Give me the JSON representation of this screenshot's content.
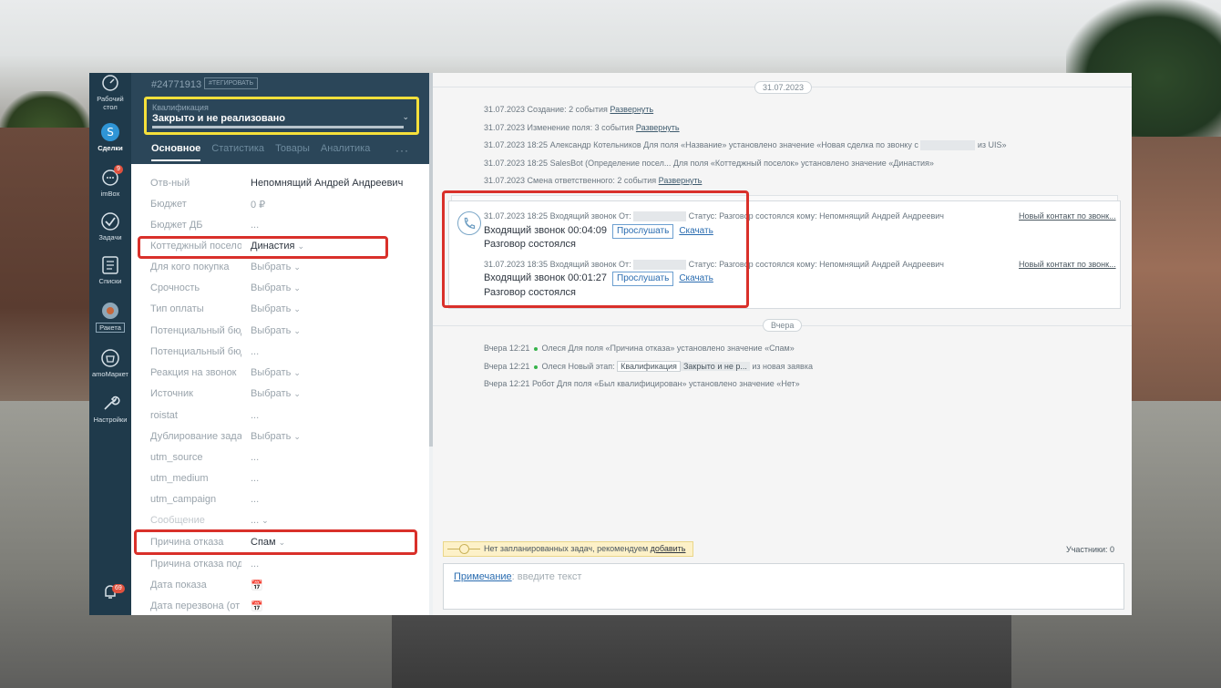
{
  "nav": {
    "items": [
      {
        "label_1": "Рабочий",
        "label_2": "стол",
        "icon": "dashboard-icon"
      },
      {
        "label": "Сделки",
        "icon": "deals-icon"
      },
      {
        "label": "imBox",
        "icon": "chat-icon",
        "badge": "9"
      },
      {
        "label": "Задачи",
        "icon": "tasks-icon"
      },
      {
        "label": "Списки",
        "icon": "lists-icon"
      },
      {
        "label": "Ракета",
        "icon": "rocket-icon"
      },
      {
        "label": "amoМаркет",
        "icon": "market-icon"
      },
      {
        "label": "Настройки",
        "icon": "settings-icon"
      }
    ],
    "notifications_badge": "69"
  },
  "card": {
    "deal_id": "#24771913",
    "tag_button": "#ТЕГИРОВАТЬ",
    "status_small": "Квалификация",
    "status_main": "Закрыто и не реализовано",
    "tabs": [
      "Основное",
      "Статистика",
      "Товары",
      "Аналитика"
    ],
    "tabs_more": "···"
  },
  "fields": [
    {
      "name": "Отв-ный",
      "value": "Непомнящий Андрей Андреевич"
    },
    {
      "name": "Бюджет",
      "value": "0 ₽"
    },
    {
      "name": "Бюджет ДБ",
      "value": "..."
    },
    {
      "name": "Коттеджный поселок",
      "value": "Династия"
    },
    {
      "name": "Для кого покупка",
      "value": "Выбрать"
    },
    {
      "name": "Срочность",
      "value": "Выбрать"
    },
    {
      "name": "Тип оплаты",
      "value": "Выбрать"
    },
    {
      "name": "Потенциальный бюд",
      "value": "Выбрать"
    },
    {
      "name": "Потенциальный бюд",
      "value": "..."
    },
    {
      "name": "Реакция на звонок",
      "value": "Выбрать"
    },
    {
      "name": "Источник",
      "value": "Выбрать"
    },
    {
      "name": "roistat",
      "value": "..."
    },
    {
      "name": "Дублирование задач",
      "value": "Выбрать"
    },
    {
      "name": "utm_source",
      "value": "..."
    },
    {
      "name": "utm_medium",
      "value": "..."
    },
    {
      "name": "utm_campaign",
      "value": "..."
    },
    {
      "name": "Сообщение",
      "value": "..."
    },
    {
      "name": "Причина отказа",
      "value": "Спам"
    },
    {
      "name": "Причина отказа подр",
      "value": "..."
    },
    {
      "name": "Дата показа",
      "value": "📅"
    },
    {
      "name": "Дата перезвона (от к",
      "value": "📅"
    }
  ],
  "feed": {
    "date1": "31.07.2023",
    "date2": "Вчера",
    "notes": [
      {
        "text": "31.07.2023 Создание: 2 события ",
        "link": "Развернуть"
      },
      {
        "text": "31.07.2023 Изменение поля: 3 события ",
        "link": "Развернуть"
      },
      {
        "text": "31.07.2023 18:25 Александр Котельников Для поля «Название» установлено значение «Новая сделка по звонку с",
        "suffix": "из UIS»"
      },
      {
        "text": "31.07.2023 18:25 SalesBot (Определение посел... Для поля «Коттеджный поселок» установлено значение «Династия»"
      },
      {
        "text": "31.07.2023 Смена ответственного: 2 события ",
        "link": "Развернуть"
      }
    ],
    "calls": [
      {
        "head_left": "31.07.2023 18:25 Входящий звонок От:",
        "head_right": "Статус: Разговор состоялся кому: Непомнящий Андрей Андреевич",
        "title": "Входящий звонок 00:04:09",
        "listen": "Прослушать",
        "download": "Скачать",
        "status": "Разговор состоялся",
        "contact": "Новый контакт по звонк..."
      },
      {
        "head_left": "31.07.2023 18:35 Входящий звонок От:",
        "head_right": "Статус: Разговор состоялся кому: Непомнящий Андрей Андреевич",
        "title": "Входящий звонок 00:01:27",
        "listen": "Прослушать",
        "download": "Скачать",
        "status": "Разговор состоялся",
        "contact": "Новый контакт по звонк..."
      }
    ],
    "yesterday": [
      {
        "pre": "Вчера 12:21",
        "text": "Олеся Для поля «Причина отказа» установлено значение «Спам»"
      },
      {
        "pre": "Вчера 12:21",
        "text": "Олеся Новый этап:",
        "tag1": "Квалификация",
        "tag2": "Закрыто и не р...",
        "suffix": "из новая заявка"
      },
      {
        "pre": "Вчера 12:21",
        "text": "Робот Для поля «Был квалифицирован» установлено значение «Нет»"
      }
    ],
    "tasks_text": "Нет запланированных задач, рекомендуем ",
    "tasks_link": "добавить",
    "participants": "Участники: 0",
    "note_link": "Примечание",
    "note_placeholder": ": введите текст"
  },
  "colors": {
    "highlight_status": "#f6e03b",
    "highlight_red": "#d9302a",
    "nav_bg": "#1f3a4b"
  }
}
